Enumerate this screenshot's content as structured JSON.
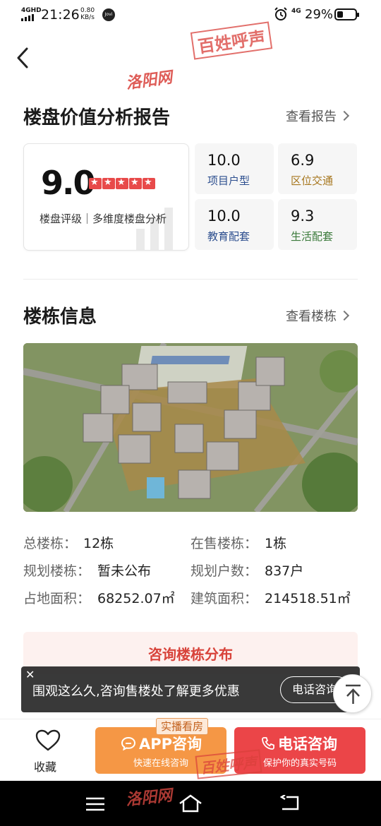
{
  "status_bar": {
    "network": "4GHD",
    "time": "21:26",
    "speed": "0.80",
    "speed_unit": "KB/s",
    "jovi": "Jovi",
    "network2": "4G",
    "battery": "29%"
  },
  "watermarks": {
    "site": "洛阳网",
    "slogan": "百姓呼声"
  },
  "value_report": {
    "title": "楼盘价值分析报告",
    "link": "查看报告",
    "score": "9.0",
    "stars": 5,
    "score_caption": "楼盘评级｜多维度楼盘分析",
    "metrics": [
      {
        "value": "10.0",
        "label": "项目户型"
      },
      {
        "value": "6.9",
        "label": "区位交通"
      },
      {
        "value": "10.0",
        "label": "教育配套"
      },
      {
        "value": "9.3",
        "label": "生活配套"
      }
    ]
  },
  "building_info": {
    "title": "楼栋信息",
    "link": "查看楼栋",
    "rows": [
      {
        "label": "总楼栋：",
        "value": "12栋",
        "label2": "在售楼栋：",
        "value2": "1栋"
      },
      {
        "label": "规划楼栋：",
        "value": "暂未公布",
        "label2": "规划户数：",
        "value2": "837户"
      },
      {
        "label": "占地面积：",
        "value": "68252.07㎡",
        "label2": "建筑面积：",
        "value2": "214518.51㎡"
      }
    ],
    "consult_button": "咨询楼栋分布"
  },
  "toast": {
    "message": "围观这么久,咨询售楼处了解更多优惠",
    "button": "电话咨询"
  },
  "bottom_bar": {
    "favorite": "收藏",
    "app_badge": "实播看房",
    "app_main": "APP咨询",
    "app_sub": "快速在线咨询",
    "call_main": "电话咨询",
    "call_sub": "保护你的真实号码"
  },
  "colors": {
    "accent_red": "#eb4548",
    "accent_orange": "#f59745",
    "star_red": "#e84a4a"
  }
}
